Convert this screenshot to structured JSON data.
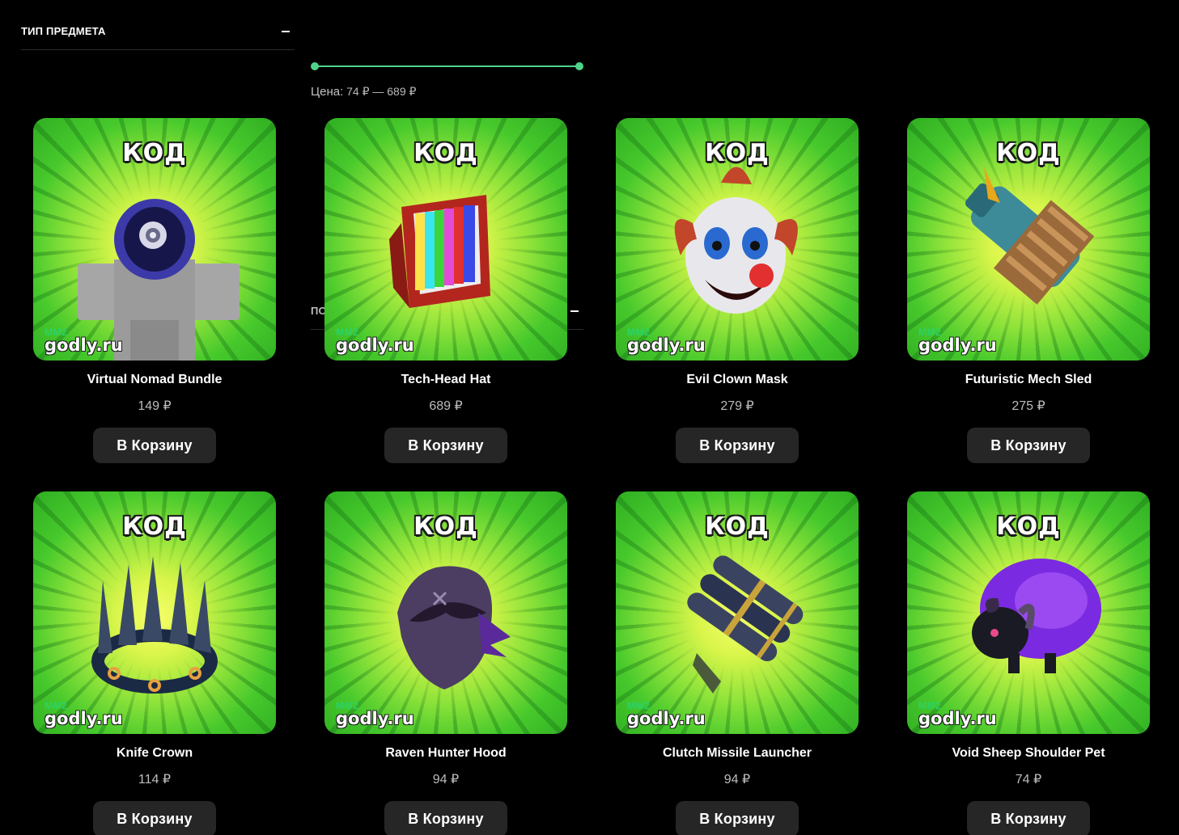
{
  "filters": {
    "type": {
      "title": "ТИП ПРЕДМЕТА",
      "toggle_icon": "minus-icon"
    },
    "price": {
      "title": "ПО ЦЕНЕ",
      "toggle_icon": "minus-icon",
      "range_label": "Цена:",
      "range_text": "74 ₽ — 689 ₽",
      "min_value": 74,
      "max_value": 689,
      "selected_min": 74,
      "selected_max": 689,
      "accent_color": "#4ed38a"
    }
  },
  "thumbnail": {
    "badge": "КОД",
    "watermark_tag": "MM2",
    "watermark_site": "godly.ru"
  },
  "products": [
    {
      "name": "Virtual Nomad Bundle",
      "price": "149 ₽",
      "button": "В Корзину",
      "art": "nomad-bundle-image"
    },
    {
      "name": "Tech-Head Hat",
      "price": "689 ₽",
      "button": "В Корзину",
      "art": "tv-head-hat-image"
    },
    {
      "name": "Evil Clown Mask",
      "price": "279 ₽",
      "button": "В Корзину",
      "art": "clown-mask-image"
    },
    {
      "name": "Futuristic Mech Sled",
      "price": "275 ₽",
      "button": "В Корзину",
      "art": "mech-sled-image"
    },
    {
      "name": "Knife Crown",
      "price": "114 ₽",
      "button": "В Корзину",
      "art": "knife-crown-image"
    },
    {
      "name": "Raven Hunter Hood",
      "price": "94 ₽",
      "button": "В Корзину",
      "art": "raven-hood-image"
    },
    {
      "name": "Clutch Missile Launcher",
      "price": "94 ₽",
      "button": "В Корзину",
      "art": "missile-launcher-image"
    },
    {
      "name": "Void Sheep Shoulder Pet",
      "price": "74 ₽",
      "button": "В Корзину",
      "art": "void-sheep-image"
    }
  ]
}
